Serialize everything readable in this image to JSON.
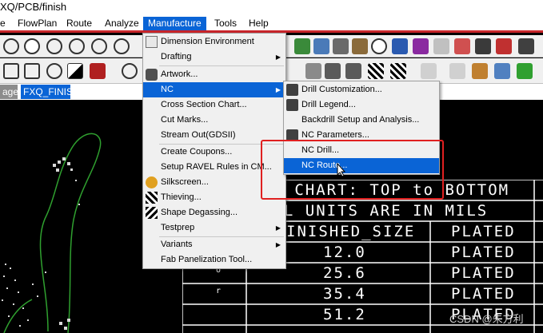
{
  "window": {
    "title": "XQ/PCB/finish"
  },
  "menubar": {
    "items": [
      {
        "label": "e"
      },
      {
        "label": "FlowPlan"
      },
      {
        "label": "Route"
      },
      {
        "label": "Analyze"
      },
      {
        "label": "Manufacture",
        "active": true
      },
      {
        "label": "Tools"
      },
      {
        "label": "Help"
      }
    ]
  },
  "tabs": [
    {
      "label": "age"
    },
    {
      "label": "FXQ_FINISH"
    }
  ],
  "manufacture_menu": {
    "items": [
      {
        "label": "Dimension Environment",
        "icon": "dimension-icon"
      },
      {
        "label": "Drafting",
        "submenu": true
      },
      {
        "label": "Artwork...",
        "icon": "artwork-icon"
      },
      {
        "label": "NC",
        "submenu": true,
        "highlighted": true
      },
      {
        "label": "Cross Section Chart..."
      },
      {
        "label": "Cut Marks..."
      },
      {
        "label": "Stream Out(GDSII)"
      },
      {
        "label": "Create Coupons..."
      },
      {
        "label": "Setup RAVEL Rules in CM..."
      },
      {
        "label": "Silkscreen...",
        "icon": "silkscreen-icon"
      },
      {
        "label": "Thieving...",
        "icon": "thieving-icon"
      },
      {
        "label": "Shape Degassing...",
        "icon": "degassing-icon"
      },
      {
        "label": "Testprep",
        "submenu": true
      },
      {
        "label": "Variants",
        "submenu": true
      },
      {
        "label": "Fab Panelization Tool..."
      }
    ]
  },
  "nc_submenu": {
    "items": [
      {
        "label": "Drill Customization...",
        "icon": "drill-customization-icon"
      },
      {
        "label": "Drill Legend...",
        "icon": "drill-legend-icon"
      },
      {
        "label": "Backdrill Setup and Analysis..."
      },
      {
        "label": "NC Parameters...",
        "icon": "nc-parameters-icon"
      },
      {
        "label": "NC Drill..."
      },
      {
        "label": "NC Route...",
        "highlighted": true
      }
    ]
  },
  "drill_chart": {
    "title": "LL CHART: TOP to BOTTOM",
    "units": "ALL UNITS ARE IN MILS",
    "headers": [
      "INISHED_SIZE",
      "PLATED"
    ],
    "rows": [
      {
        "symbol": "",
        "size": "12.0",
        "plated": "PLATED"
      },
      {
        "symbol": "o",
        "size": "25.6",
        "plated": "PLATED"
      },
      {
        "symbol": "r",
        "size": "35.4",
        "plated": "PLATED"
      },
      {
        "symbol": "",
        "size": "51.2",
        "plated": "PLATED"
      }
    ]
  },
  "watermark": "CSDN @朱方利",
  "colors": {
    "menu_highlight": "#0a64d6",
    "annotation_box": "#e02020",
    "menubar_border": "#c8252a"
  }
}
